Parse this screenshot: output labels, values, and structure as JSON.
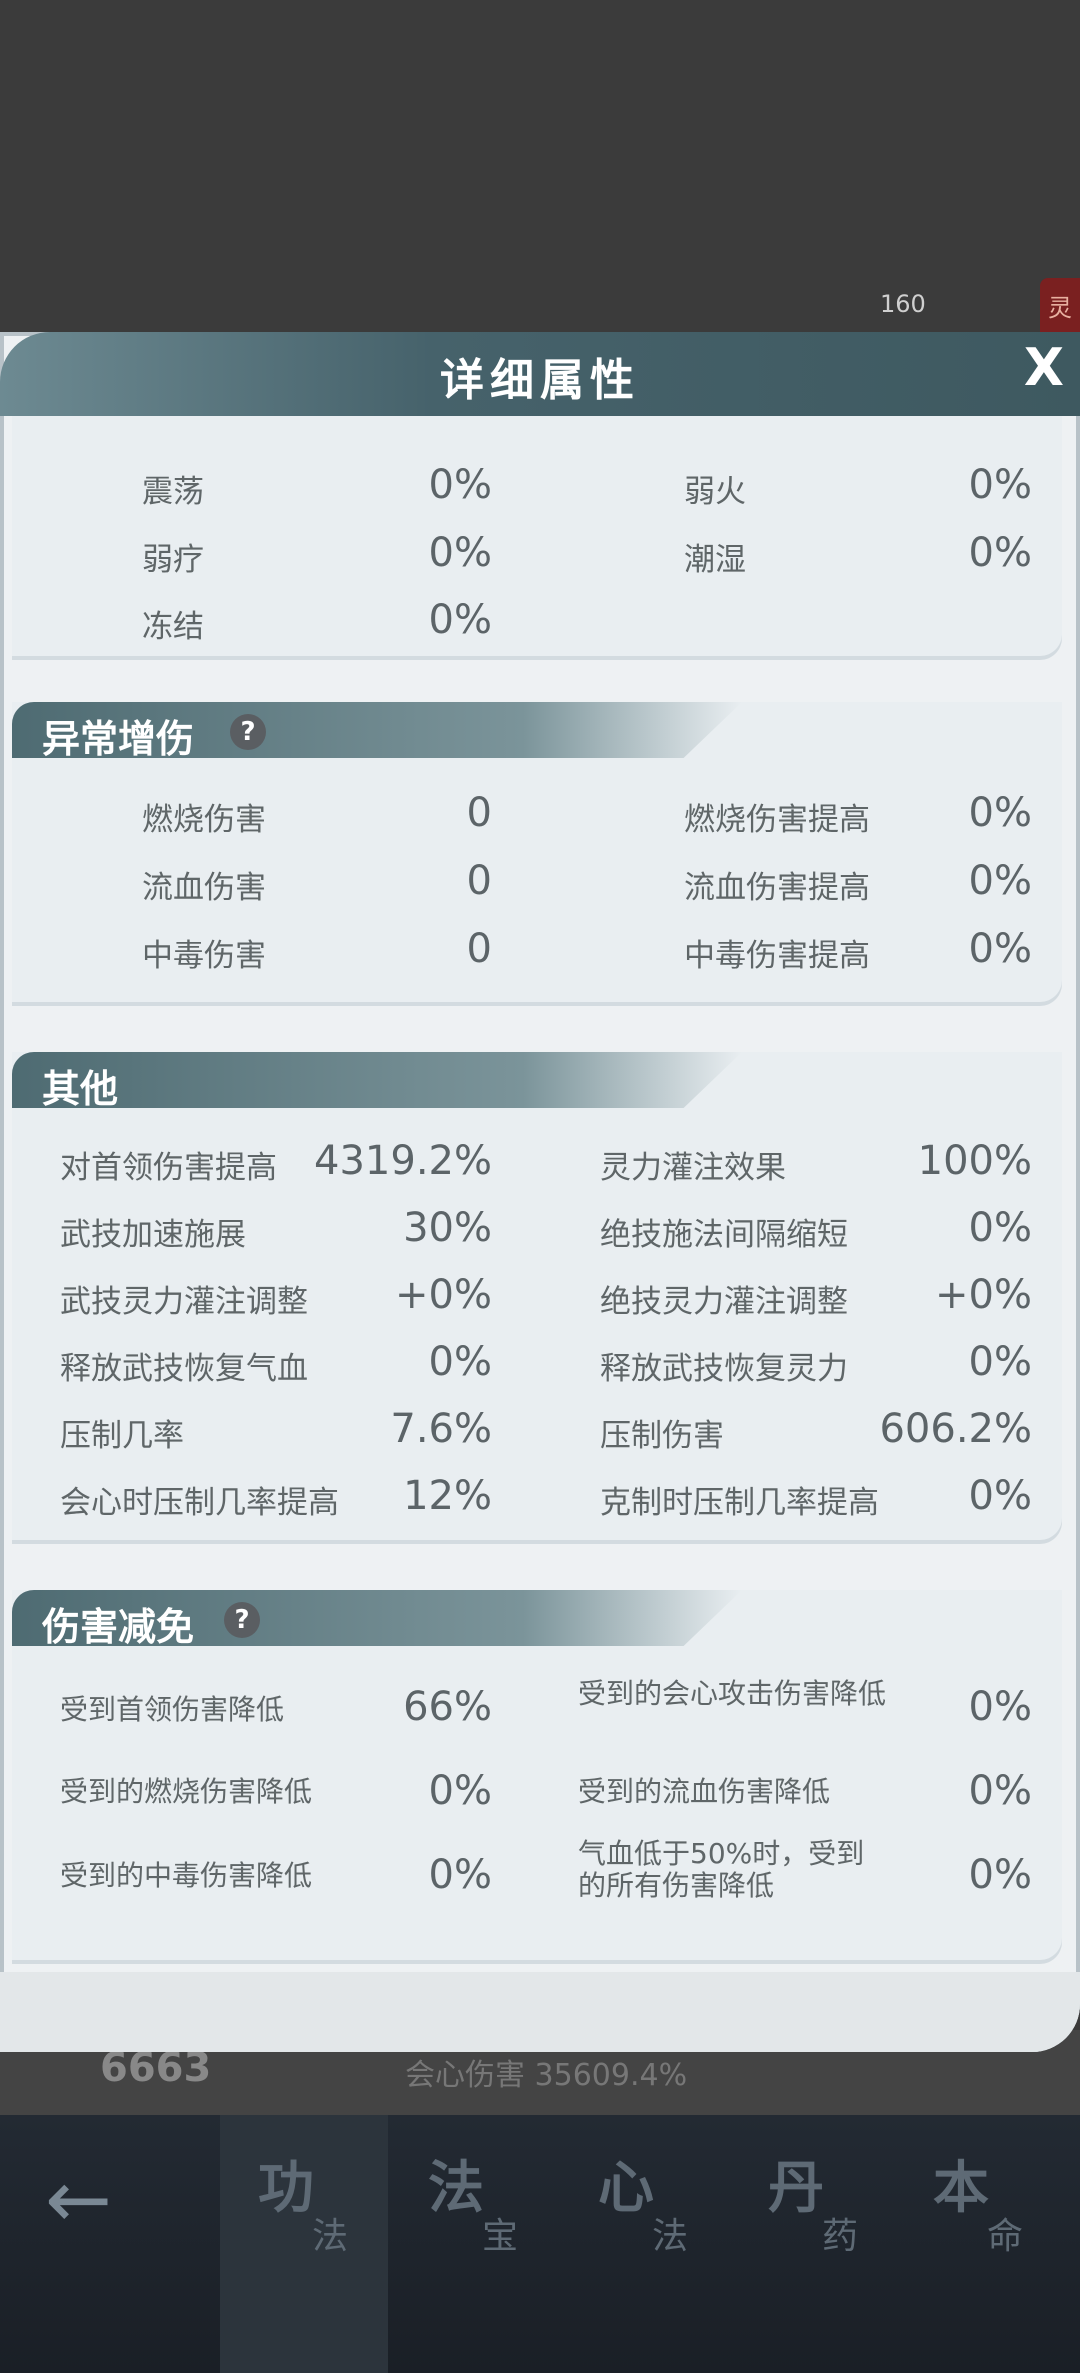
{
  "background": {
    "level_number": "160",
    "side_tag": "灵",
    "strip_value": "6663",
    "strip_text": "会心伤害 35609.4%"
  },
  "dialog": {
    "title": "详细属性",
    "close_symbol": "X"
  },
  "resist": {
    "rows": [
      {
        "left_label": "震荡",
        "left_value": "0%",
        "right_label": "弱火",
        "right_value": "0%"
      },
      {
        "left_label": "弱疗",
        "left_value": "0%",
        "right_label": "潮湿",
        "right_value": "0%"
      },
      {
        "left_label": "冻结",
        "left_value": "0%"
      }
    ]
  },
  "abnormal": {
    "title": "异常增伤",
    "help": "?",
    "rows": [
      {
        "left_label": "燃烧伤害",
        "left_value": "0",
        "right_label": "燃烧伤害提高",
        "right_value": "0%"
      },
      {
        "left_label": "流血伤害",
        "left_value": "0",
        "right_label": "流血伤害提高",
        "right_value": "0%"
      },
      {
        "left_label": "中毒伤害",
        "left_value": "0",
        "right_label": "中毒伤害提高",
        "right_value": "0%"
      }
    ]
  },
  "other": {
    "title": "其他",
    "rows": [
      {
        "left_label": "对首领伤害提高",
        "left_value": "4319.2%",
        "right_label": "灵力灌注效果",
        "right_value": "100%"
      },
      {
        "left_label": "武技加速施展",
        "left_value": "30%",
        "right_label": "绝技施法间隔缩短",
        "right_value": "0%"
      },
      {
        "left_label": "武技灵力灌注调整",
        "left_value": "+0%",
        "right_label": "绝技灵力灌注调整",
        "right_value": "+0%"
      },
      {
        "left_label": "释放武技恢复气血",
        "left_value": "0%",
        "right_label": "释放武技恢复灵力",
        "right_value": "0%"
      },
      {
        "left_label": "压制几率",
        "left_value": "7.6%",
        "right_label": "压制伤害",
        "right_value": "606.2%"
      },
      {
        "left_label": "会心时压制几率提高",
        "left_value": "12%",
        "right_label": "克制时压制几率提高",
        "right_value": "0%"
      }
    ]
  },
  "reduction": {
    "title": "伤害减免",
    "help": "?",
    "rows": [
      {
        "left_label": "受到首领伤害降低",
        "left_value": "66%",
        "right_label": "受到的会心攻击伤害降低",
        "right_value": "0%"
      },
      {
        "left_label": "受到的燃烧伤害降低",
        "left_value": "0%",
        "right_label": "受到的流血伤害降低",
        "right_value": "0%"
      },
      {
        "left_label": "受到的中毒伤害降低",
        "left_value": "0%",
        "right_label": "气血低于50%时，受到的所有伤害降低",
        "right_value": "0%"
      }
    ]
  },
  "nav": {
    "back_symbol": "←",
    "tabs": [
      {
        "big": "功",
        "small": "法"
      },
      {
        "big": "法",
        "small": "宝"
      },
      {
        "big": "心",
        "small": "法"
      },
      {
        "big": "丹",
        "small": "药"
      },
      {
        "big": "本",
        "small": "命"
      }
    ]
  }
}
